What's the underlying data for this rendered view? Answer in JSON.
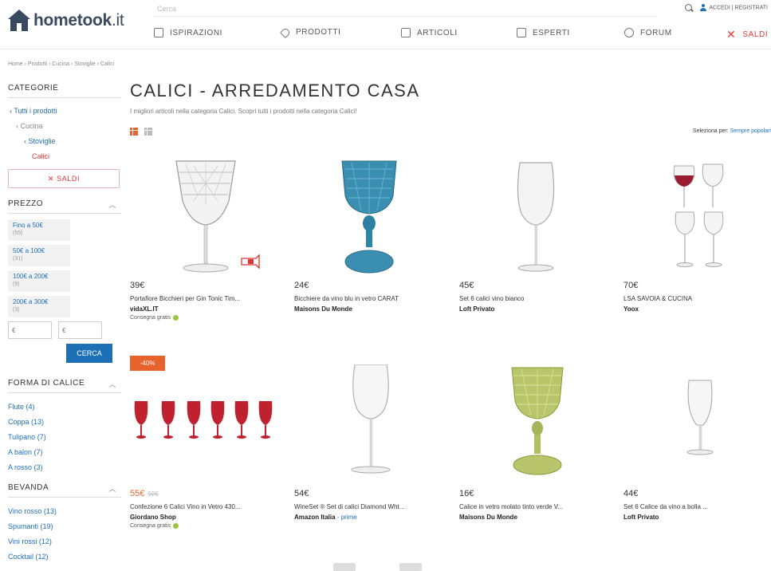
{
  "header": {
    "logo_main": "hometook",
    "logo_tld": ".it",
    "search_placeholder": "Cerca",
    "account_label": "ACCEDI | REGISTRATI"
  },
  "nav": [
    {
      "label": "ISPIRAZIONI",
      "icon": "inspiration-icon"
    },
    {
      "label": "PRODOTTI",
      "icon": "tag-icon"
    },
    {
      "label": "ARTICOLI",
      "icon": "article-icon"
    },
    {
      "label": "ESPERTI",
      "icon": "expert-icon"
    },
    {
      "label": "FORUM",
      "icon": "forum-icon"
    },
    {
      "label": "SALDI",
      "icon": "sale-icon"
    }
  ],
  "breadcrumb": "Home › Prodotti › Cucina › Stoviglie › Calici",
  "sidebar": {
    "categories_title": "CATEGORIE",
    "categories": [
      {
        "label": "‹ Tutti i prodotti",
        "state": "link"
      },
      {
        "label": "‹ Cucina",
        "state": "muted"
      },
      {
        "label": "‹ Stoviglie",
        "state": "link"
      },
      {
        "label": "Calici",
        "state": "active"
      }
    ],
    "saldi_label": "✕ SALDI",
    "price_title": "PREZZO",
    "price_options": [
      {
        "label": "Fino a 50€",
        "count": "(55)"
      },
      {
        "label": "50€ a 100€",
        "count": "(31)"
      },
      {
        "label": "100€ a 200€",
        "count": "(9)"
      },
      {
        "label": "200€ a 300€",
        "count": "(3)"
      }
    ],
    "price_min_placeholder": "€",
    "price_max_placeholder": "€",
    "cerca_label": "CERCA",
    "shape_title": "FORMA DI CALICE",
    "shapes": [
      "Flute (4)",
      "Coppa (13)",
      "Tulipano (7)",
      "A balon (7)",
      "A rosso (3)"
    ],
    "drink_title": "BEVANDA",
    "drinks": [
      "Vino rosso (13)",
      "Spumanti (19)",
      "Vini rossi (12)",
      "Cocktail (12)"
    ]
  },
  "main": {
    "title": "CALICI - ARREDAMENTO CASA",
    "subtitle": "I migliori articoli nella categoria Calici. Scopri tutti i prodotti nella categoria Calici!",
    "sort_label": "Seleziona per:",
    "sort_value": "Sempre popolari",
    "discount_badge": "-40%"
  },
  "products": [
    {
      "price": "39€",
      "old_price": "",
      "name": "Portafiore Bicchieri per Gin Tonic Tim...",
      "seller": "vidaXL.IT",
      "seller_extra": "",
      "shipping": "Consegna gratis"
    },
    {
      "price": "24€",
      "old_price": "",
      "name": "Bicchiere da vino blu in vetro CARAT",
      "seller": "Maisons Du Monde",
      "seller_extra": "",
      "shipping": ""
    },
    {
      "price": "45€",
      "old_price": "",
      "name": "Set 6 calici vino bianco",
      "seller": "Loft Privato",
      "seller_extra": "",
      "shipping": ""
    },
    {
      "price": "70€",
      "old_price": "",
      "name": "LSA SAVOIA & CUCINA",
      "seller": "Yoox",
      "seller_extra": "",
      "shipping": ""
    },
    {
      "price": "55€",
      "old_price": "92€",
      "name": "Confezione 6 Calici Vino in Vetro 430...",
      "seller": "Giordano Shop",
      "seller_extra": "",
      "shipping": "Consegna gratis"
    },
    {
      "price": "54€",
      "old_price": "",
      "name": "WineSet ® Set di calici Diamond Wht...",
      "seller": "Amazon Italia",
      "seller_extra": "- prime",
      "shipping": ""
    },
    {
      "price": "16€",
      "old_price": "",
      "name": "Calice in vetro molato tinto verde V...",
      "seller": "Maisons Du Monde",
      "seller_extra": "",
      "shipping": ""
    },
    {
      "price": "44€",
      "old_price": "",
      "name": "Set 6 Calice da vino a bolla ...",
      "seller": "Loft Privato",
      "seller_extra": "",
      "shipping": ""
    }
  ]
}
